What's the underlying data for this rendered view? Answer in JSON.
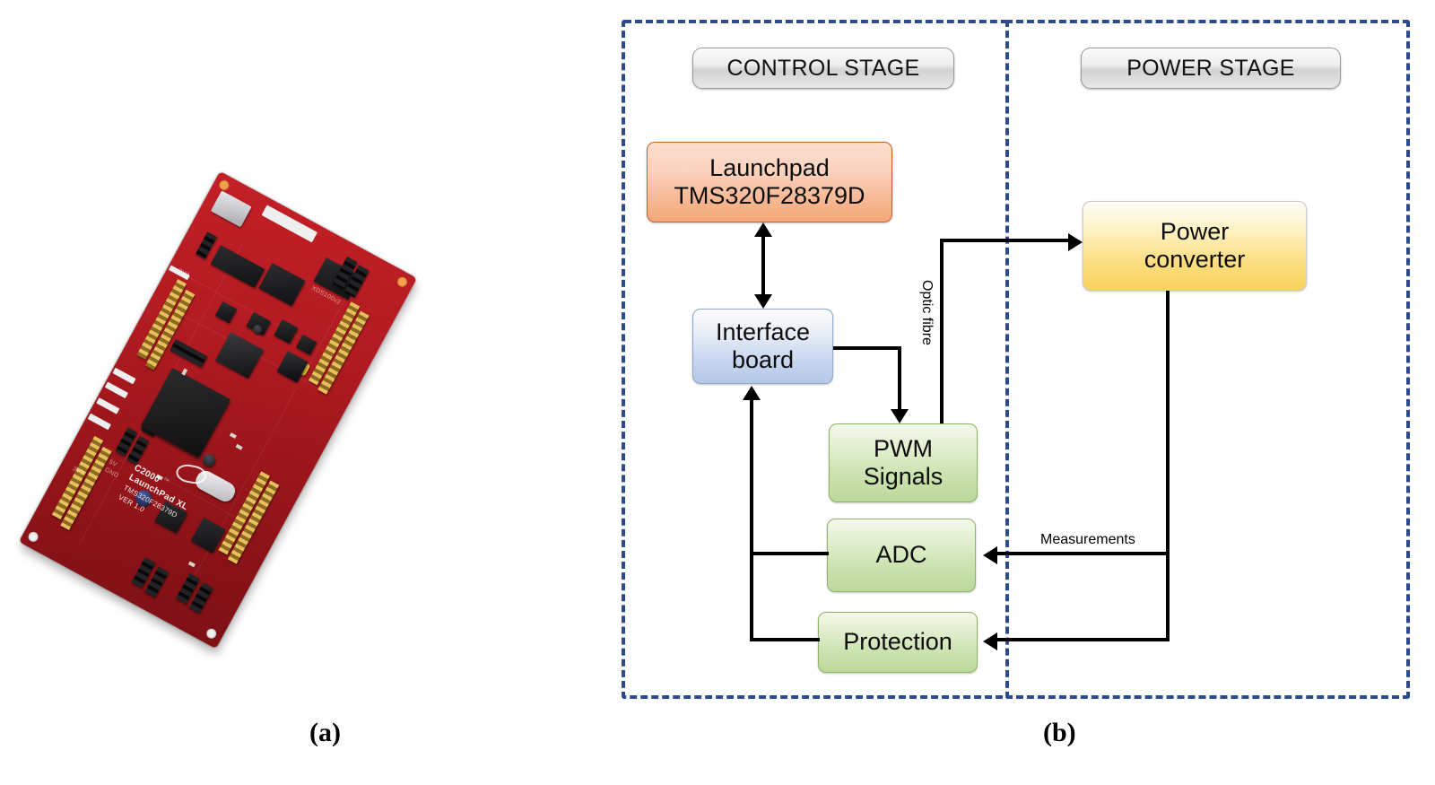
{
  "figure": {
    "caption_a": "(a)",
    "caption_b": "(b)"
  },
  "photo": {
    "alt_name": "c2000-launchpad-xl-photo",
    "silkscreen": {
      "brand": "C2000",
      "tm": "™",
      "board_name": "LaunchPad XL",
      "part_number": "TMS320F28379D",
      "revision": "VER 1.0",
      "debugger": "XDS100v2",
      "pin_label_5v": "5V",
      "pin_label_gnd": "GND",
      "pin_label_3v3": "3V3"
    }
  },
  "diagram": {
    "type": "block-diagram",
    "stages": [
      {
        "id": "control",
        "label": "CONTROL STAGE"
      },
      {
        "id": "power",
        "label": "POWER STAGE"
      }
    ],
    "nodes": [
      {
        "id": "launchpad",
        "line1": "Launchpad",
        "line2": "TMS320F28379D",
        "color": "#f3a678",
        "stage": "control"
      },
      {
        "id": "interface",
        "line1": "Interface",
        "line2": "board",
        "color": "#b4c8e8",
        "stage": "control"
      },
      {
        "id": "pwm",
        "line1": "PWM",
        "line2": "Signals",
        "color": "#bcd99b",
        "stage": "control"
      },
      {
        "id": "adc",
        "line1": "ADC",
        "line2": "",
        "color": "#bcd99b",
        "stage": "control"
      },
      {
        "id": "protection",
        "line1": "Protection",
        "line2": "",
        "color": "#bcd99b",
        "stage": "control"
      },
      {
        "id": "converter",
        "line1": "Power",
        "line2": "converter",
        "color": "#f9d35e",
        "stage": "power"
      }
    ],
    "edges": [
      {
        "from": "launchpad",
        "to": "interface",
        "label": "",
        "bidirectional": true
      },
      {
        "from": "interface",
        "to": "pwm",
        "label": ""
      },
      {
        "from": "pwm",
        "to": "converter",
        "label": "Optic fibre"
      },
      {
        "from": "converter",
        "to": "adc",
        "label": "Measurements"
      },
      {
        "from": "converter",
        "to": "protection",
        "label": ""
      },
      {
        "from": "adc",
        "to": "interface",
        "label": ""
      },
      {
        "from": "protection",
        "to": "interface",
        "label": ""
      }
    ],
    "edge_labels": {
      "optic_fibre": "Optic fibre",
      "measurements": "Measurements"
    },
    "colors": {
      "boundary_dash": "#2e4a8f",
      "edge": "#000000",
      "stage_pill": "#ededed"
    }
  }
}
